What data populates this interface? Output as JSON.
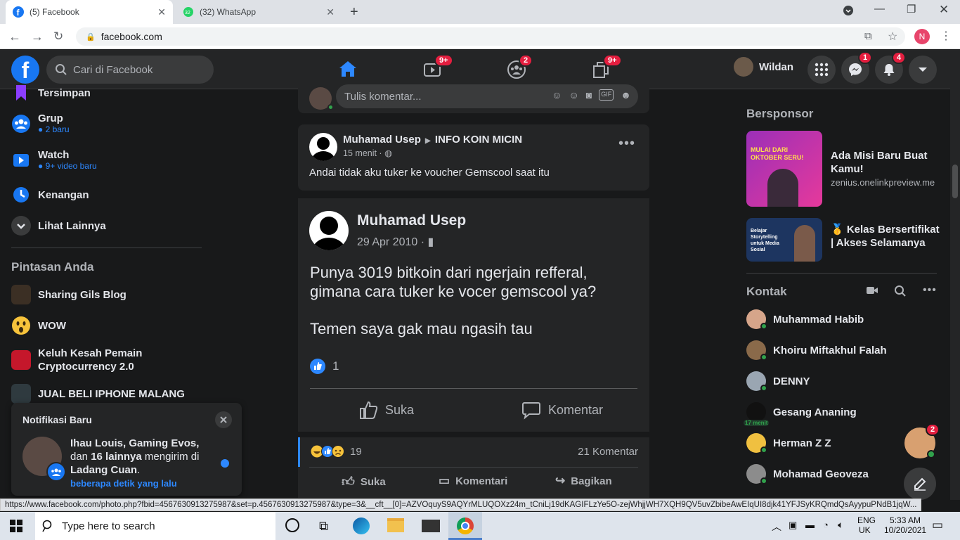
{
  "browser": {
    "tabs": [
      {
        "label": "(5) Facebook",
        "icon": "facebook-icon"
      },
      {
        "label": "(32) WhatsApp",
        "icon": "whatsapp-icon"
      }
    ],
    "url": "facebook.com",
    "profile_initial": "N"
  },
  "header": {
    "search_placeholder": "Cari di Facebook",
    "badges": {
      "watch": "9+",
      "groups": "2",
      "gaming": "9+",
      "messenger": "1",
      "notifications": "4"
    },
    "user_name": "Wildan"
  },
  "left": {
    "items": [
      {
        "label": "Tersimpan",
        "sub": ""
      },
      {
        "label": "Grup",
        "sub": "● 2 baru"
      },
      {
        "label": "Watch",
        "sub": "● 9+ video baru"
      },
      {
        "label": "Kenangan",
        "sub": ""
      },
      {
        "label": "Lihat Lainnya",
        "sub": ""
      }
    ],
    "shortcuts_title": "Pintasan Anda",
    "shortcuts": [
      {
        "label": "Sharing Gils Blog"
      },
      {
        "label": "WOW"
      },
      {
        "label": "Keluh Kesah Pemain Cryptocurrency 2.0"
      },
      {
        "label": "JUAL BELI IPHONE MALANG"
      }
    ]
  },
  "notification": {
    "title": "Notifikasi Baru",
    "text_bold1": "Ihau Louis, Gaming Evos,",
    "text_rest": " dan ",
    "text_bold2": "16 lainnya",
    "text_end": " mengirim di ",
    "text_bold3": "Ladang Cuan",
    "text_dot": ".",
    "time": "beberapa detik yang lalu"
  },
  "feed": {
    "comment_placeholder": "Tulis komentar...",
    "post1": {
      "author": "Muhamad Usep",
      "group": "INFO KOIN MICIN",
      "time": "15 menit ·",
      "text": "Andai tidak aku tuker ke voucher Gemscool saat itu"
    },
    "photo_post": {
      "author": "Muhamad Usep",
      "date": "29 Apr 2010 ·",
      "line1": "Punya 3019 bitkoin dari ngerjain refferal,",
      "line2": "gimana cara tuker ke vocer gemscool ya?",
      "line3": "Temen saya gak mau ngasih tau",
      "likes": "1",
      "like_label": "Suka",
      "comment_label": "Komentar"
    },
    "post1_footer": {
      "reactions": "19",
      "comments": "21 Komentar",
      "like": "Suka",
      "comment": "Komentari",
      "share": "Bagikan"
    }
  },
  "right": {
    "sponsored_title": "Bersponsor",
    "ads": [
      {
        "title": "Ada Misi Baru Buat Kamu!",
        "domain": "zenius.onelinkpreview.me",
        "img_text": "MULAI DARI OKTOBER SERU!"
      },
      {
        "title": "🥇 Kelas Bersertifikat | Akses Selamanya",
        "img_text": "Belajar Storytelling untuk Media Sosial"
      }
    ],
    "contacts_title": "Kontak",
    "contacts": [
      {
        "name": "Muhammad Habib",
        "online": true
      },
      {
        "name": "Khoiru Miftakhul Falah",
        "online": true
      },
      {
        "name": "DENNY",
        "online": true
      },
      {
        "name": "Gesang Ananing",
        "online": false,
        "badge": "17 menit"
      },
      {
        "name": "Herman Z Z",
        "online": true
      },
      {
        "name": "Mohamad Geoveza",
        "online": true
      }
    ],
    "chat_badge": "2"
  },
  "status_url": "https://www.facebook.com/photo.php?fbid=4567630913275987&set=p.4567630913275987&type=3&__cft__[0]=AZVOquyS9AQYrMLUQOXz24m_tCniLj19dKAGIFLzYe5O-zejWhjjWH7XQH9QV5uvZbibeAwEIqUI8djk41YFJSyKRQmdQsAyypuPNdB1jqW...",
  "taskbar": {
    "search_placeholder": "Type here to search",
    "lang1": "ENG",
    "lang2": "UK",
    "time": "5:33 AM",
    "date": "10/20/2021"
  },
  "colors": {
    "fb_blue": "#1877f2",
    "accent": "#2d88ff",
    "badge_red": "#e41e3f",
    "online": "#31a24c"
  }
}
